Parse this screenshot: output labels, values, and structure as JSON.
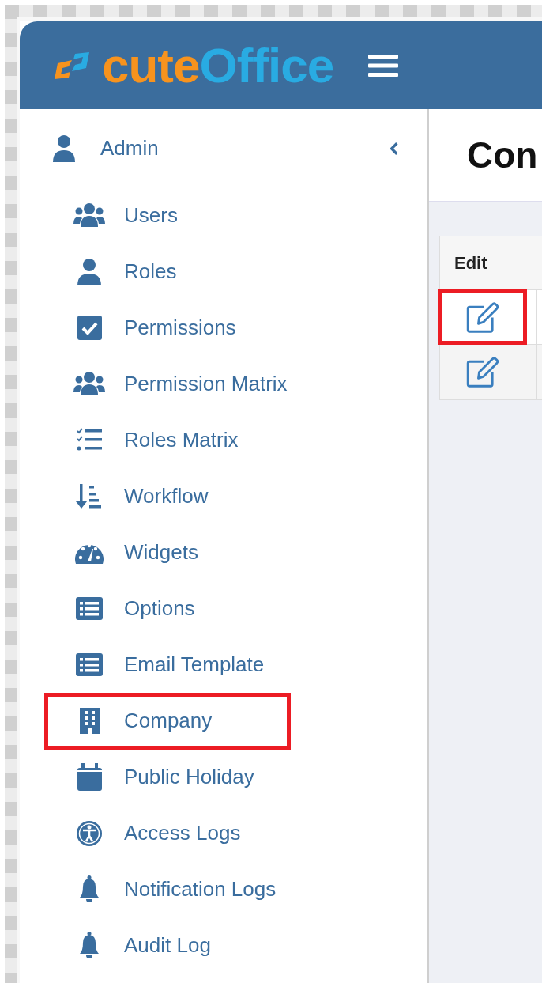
{
  "header": {
    "logo": [
      {
        "text": "cute",
        "color": "#f7931e"
      },
      {
        "text": "Office",
        "color": "#29abe2"
      }
    ]
  },
  "sidebar": {
    "section": {
      "label": "Admin",
      "expanded": true
    },
    "items": [
      {
        "label": "Users",
        "highlighted": false
      },
      {
        "label": "Roles",
        "highlighted": false
      },
      {
        "label": "Permissions",
        "highlighted": false
      },
      {
        "label": "Permission Matrix",
        "highlighted": false
      },
      {
        "label": "Roles Matrix",
        "highlighted": false
      },
      {
        "label": "Workflow",
        "highlighted": false
      },
      {
        "label": "Widgets",
        "highlighted": false
      },
      {
        "label": "Options",
        "highlighted": false
      },
      {
        "label": "Email Template",
        "highlighted": false
      },
      {
        "label": "Company",
        "highlighted": true
      },
      {
        "label": "Public Holiday",
        "highlighted": false
      },
      {
        "label": "Access Logs",
        "highlighted": false
      },
      {
        "label": "Notification Logs",
        "highlighted": false
      },
      {
        "label": "Audit Log",
        "highlighted": false
      }
    ]
  },
  "page": {
    "title": "Con"
  },
  "table": {
    "columns": [
      "Edit"
    ],
    "rows": [
      {
        "highlighted": true
      },
      {
        "highlighted": false
      }
    ]
  }
}
